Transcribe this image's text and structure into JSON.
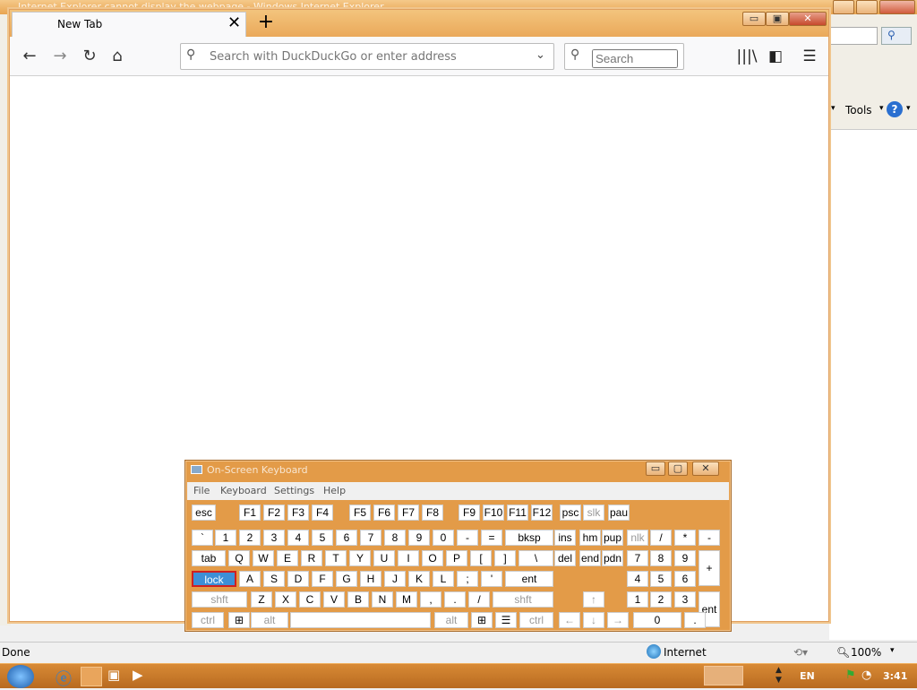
{
  "ie": {
    "title": "Internet Explorer cannot display the webpage - Windows Internet Explorer",
    "tools_label": "Tools",
    "status_done": "Done",
    "status_zone": "Internet",
    "zoom": "100%"
  },
  "firefox": {
    "tab_title": "New Tab",
    "url_placeholder": "Search with DuckDuckGo or enter address",
    "search_placeholder": "Search"
  },
  "osk": {
    "title": "On-Screen Keyboard",
    "menus": [
      "File",
      "Keyboard",
      "Settings",
      "Help"
    ],
    "keys": [
      {
        "label": "esc",
        "row": 0,
        "col": 0,
        "w": 1
      },
      {
        "label": "F1"
      },
      {
        "label": "F2"
      },
      {
        "label": "F3"
      },
      {
        "label": "F4"
      },
      {
        "label": "F5"
      },
      {
        "label": "F6"
      },
      {
        "label": "F7"
      },
      {
        "label": "F8"
      },
      {
        "label": "F9"
      },
      {
        "label": "F10"
      },
      {
        "label": "F11"
      },
      {
        "label": "F12"
      },
      {
        "label": "psc"
      },
      {
        "label": "slk"
      },
      {
        "label": "pau"
      }
    ],
    "row1": [
      "`",
      "1",
      "2",
      "3",
      "4",
      "5",
      "6",
      "7",
      "8",
      "9",
      "0",
      "-",
      "=",
      "bksp",
      "ins",
      "hm",
      "pup",
      "nlk",
      "/",
      "*",
      "-"
    ],
    "row2": [
      "tab",
      "Q",
      "W",
      "E",
      "R",
      "T",
      "Y",
      "U",
      "I",
      "O",
      "P",
      "[",
      "]",
      "\\",
      "del",
      "end",
      "pdn",
      "7",
      "8",
      "9",
      "+"
    ],
    "row3": [
      "lock",
      "A",
      "S",
      "D",
      "F",
      "G",
      "H",
      "J",
      "K",
      "L",
      ";",
      "'",
      "ent",
      "4",
      "5",
      "6"
    ],
    "row4": [
      "shft",
      "Z",
      "X",
      "C",
      "V",
      "B",
      "N",
      "M",
      ",",
      ".",
      "/",
      "shft",
      "↑",
      "1",
      "2",
      "3",
      "ent"
    ],
    "row5": [
      "ctrl",
      "⊞",
      "alt",
      "",
      "alt",
      "⊞",
      "☰",
      "ctrl",
      "←",
      "↓",
      "→",
      "0",
      "."
    ],
    "frow": [
      "esc",
      "F1",
      "F2",
      "F3",
      "F4",
      "F5",
      "F6",
      "F7",
      "F8",
      "F9",
      "F10",
      "F11",
      "F12",
      "psc",
      "slk",
      "pau"
    ]
  },
  "taskbar": {
    "lang": "EN",
    "time": "3:41"
  }
}
